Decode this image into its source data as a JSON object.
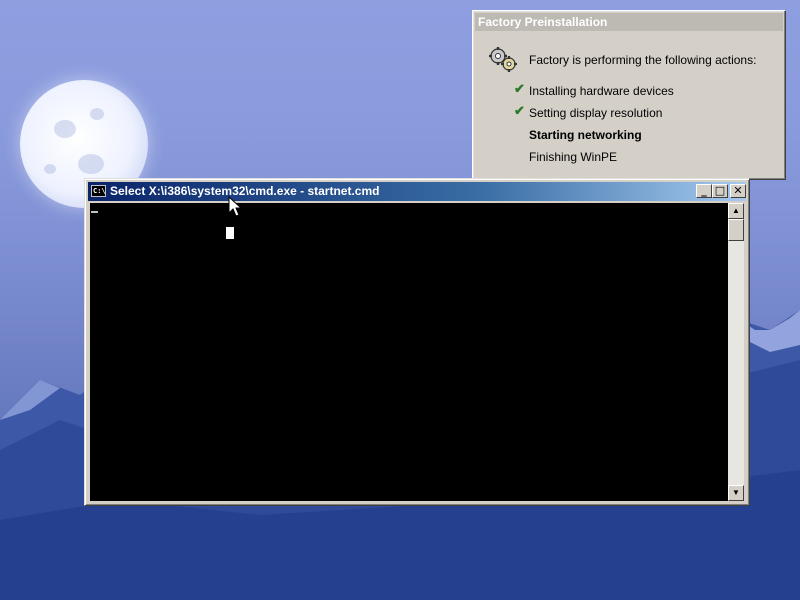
{
  "factory_window": {
    "title": "Factory Preinstallation",
    "heading": "Factory is performing the following actions:",
    "actions": [
      {
        "label": "Installing hardware devices",
        "state": "done"
      },
      {
        "label": "Setting display resolution",
        "state": "done"
      },
      {
        "label": "Starting networking",
        "state": "current"
      },
      {
        "label": "Finishing WinPE",
        "state": "pending"
      }
    ],
    "check_glyph": "✔",
    "icon": "gears-icon"
  },
  "cmd_window": {
    "title": "Select X:\\i386\\system32\\cmd.exe - startnet.cmd",
    "icon_text": "C:\\",
    "buttons": {
      "minimize": "_",
      "maximize": "□",
      "close": "✕"
    },
    "console_text": "",
    "scroll_up": "▲",
    "scroll_down": "▼"
  },
  "colors": {
    "title_active_start": "#0a246a",
    "title_active_end": "#a6caf0",
    "title_inactive": "#bdbab3",
    "check": "#2a7a2a",
    "console_bg": "#000000"
  }
}
